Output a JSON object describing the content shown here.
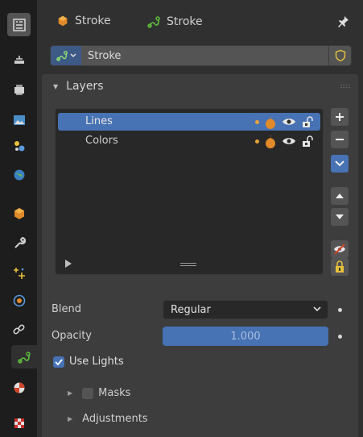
{
  "header": {
    "object_name": "Stroke",
    "data_name": "Stroke"
  },
  "datablock": {
    "name": "Stroke"
  },
  "layers_panel": {
    "title": "Layers",
    "items": [
      {
        "label": "Lines",
        "selected": true
      },
      {
        "label": "Colors",
        "selected": false
      }
    ]
  },
  "properties": {
    "blend_label": "Blend",
    "blend_value": "Regular",
    "opacity_label": "Opacity",
    "opacity_value": "1.000",
    "use_lights_label": "Use Lights",
    "use_lights_checked": true
  },
  "subpanels": {
    "masks_label": "Masks",
    "adjustments_label": "Adjustments"
  },
  "colors": {
    "accent": "#4772b3",
    "orange": "#e9a23b",
    "green": "#5fbf3f"
  },
  "tabs": [
    "tool-icon",
    "render-icon",
    "output-icon",
    "view-layer-icon",
    "scene-icon",
    "world-icon",
    "object-icon",
    "modifier-icon",
    "effects-icon",
    "physics-icon",
    "constraints-icon",
    "object-data-icon",
    "material-icon",
    "texture-icon"
  ]
}
